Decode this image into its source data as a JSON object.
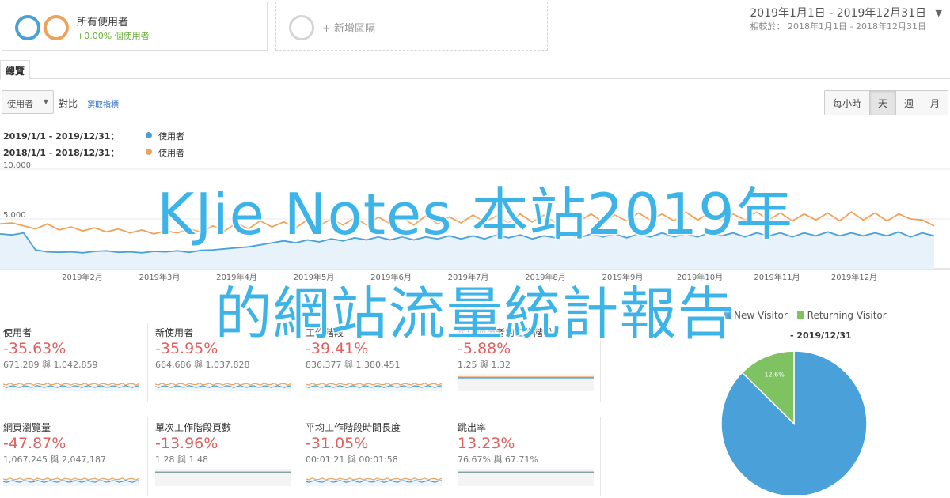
{
  "segments": {
    "all_users": {
      "title": "所有使用者",
      "subtitle": "+0.00% 個使用者"
    },
    "add_segment": {
      "label": "+ 新增區隔"
    }
  },
  "date_range": {
    "main": "2019年1月1日 - 2019年12月31日",
    "compare": "相較於：  2018年1月1日 - 2018年12月31日"
  },
  "tabs": {
    "overview": "總覽"
  },
  "controls": {
    "metric_select": "使用者",
    "vs": "對比",
    "pick_metric": "選取指標",
    "periods": [
      "每小時",
      "天",
      "週",
      "月"
    ],
    "active_period": "天"
  },
  "legend": [
    {
      "range": "2019/1/1 - 2019/12/31：",
      "name": "使用者",
      "color": "#4aa0d8"
    },
    {
      "range": "2018/1/1 - 2018/12/31：",
      "name": "使用者",
      "color": "#f0a25a"
    }
  ],
  "chart_data": {
    "type": "line",
    "y_ticks": [
      "10,000",
      "5,000"
    ],
    "ylim": [
      0,
      10000
    ],
    "grid": true,
    "x_ticks": [
      "2019年2月",
      "2019年3月",
      "2019年4月",
      "2019年5月",
      "2019年6月",
      "2019年7月",
      "2019年8月",
      "2019年9月",
      "2019年10月",
      "2019年11月",
      "2019年12月"
    ],
    "series": [
      {
        "name": "使用者",
        "period": "2019",
        "color": "#4aa0d8",
        "values": [
          3500,
          3400,
          3600,
          1900,
          1700,
          1650,
          1700,
          1600,
          1750,
          1800,
          1650,
          1700,
          1600,
          1750,
          1700,
          1800,
          1650,
          1850,
          1900,
          2000,
          2100,
          2200,
          2400,
          2600,
          2800,
          2600,
          2900,
          2700,
          3000,
          2800,
          3100,
          2900,
          3200,
          2900,
          3200,
          2900,
          3200,
          3000,
          3300,
          3000,
          3300,
          3000,
          3400,
          3100,
          3400,
          3000,
          3300,
          3100,
          3400,
          3100,
          3500,
          3200,
          3500,
          3100,
          3500,
          3200,
          3600,
          3200,
          3500,
          3200,
          3600,
          3300,
          3600,
          3200,
          3600,
          3300,
          3600,
          3200,
          3600,
          3300,
          3700,
          3300,
          3600,
          3300,
          3600,
          3300,
          3700,
          3200,
          3600,
          3300
        ]
      },
      {
        "name": "使用者",
        "period": "2018",
        "color": "#f0a25a",
        "values": [
          4500,
          4600,
          4300,
          4000,
          4500,
          3900,
          4200,
          3800,
          4100,
          3700,
          4000,
          3600,
          3900,
          3500,
          3800,
          3600,
          4000,
          3700,
          4300,
          3800,
          4600,
          4000,
          4800,
          4200,
          4700,
          4100,
          4900,
          4300,
          5000,
          4400,
          5100,
          4400,
          5200,
          4500,
          5100,
          4400,
          5300,
          4500,
          5200,
          4600,
          5400,
          4700,
          5300,
          4600,
          5500,
          4700,
          5400,
          4600,
          5600,
          4800,
          5500,
          4700,
          5400,
          4800,
          5600,
          4900,
          5500,
          4800,
          5700,
          4900,
          5600,
          4800,
          5500,
          4900,
          5700,
          4900,
          5600,
          4800,
          5500,
          4900,
          5600,
          4800,
          5700,
          4900,
          5600,
          4800,
          5500,
          5000,
          4900,
          4300
        ]
      }
    ]
  },
  "scorecards": [
    {
      "name": "使用者",
      "pct": "-35.63%",
      "vals": "671,289 與 1,042,859",
      "type": "line"
    },
    {
      "name": "新使用者",
      "pct": "-35.95%",
      "vals": "664,686 與 1,037,828",
      "type": "line"
    },
    {
      "name": "工作階段",
      "pct": "-39.41%",
      "vals": "836,377 與 1,380,451",
      "type": "line"
    },
    {
      "name": "每位使用者的工作階段",
      "pct": "-5.88%",
      "vals": "1.25 與 1.32",
      "type": "flat"
    },
    {
      "name": "網頁瀏覽量",
      "pct": "-47.87%",
      "vals": "1,067,245 與 2,047,187",
      "type": "line"
    },
    {
      "name": "單次工作階段頁數",
      "pct": "-13.96%",
      "vals": "1.28 與 1.48",
      "type": "flat"
    },
    {
      "name": "平均工作階段時間長度",
      "pct": "-31.05%",
      "vals": "00:01:21 與 00:01:58",
      "type": "line"
    },
    {
      "name": "跳出率",
      "pct": "13.23%",
      "vals": "76.67% 與 67.71%",
      "type": "flat"
    }
  ],
  "pie": {
    "legend": [
      {
        "label": "New Visitor",
        "color": "#4aa0d8"
      },
      {
        "label": "Returning Visitor",
        "color": "#7ec261"
      }
    ],
    "range": "- 2019/12/31",
    "slices": [
      {
        "label": "87.4%",
        "value": 87.4,
        "color": "#4aa0d8"
      },
      {
        "label": "12.6%",
        "value": 12.6,
        "color": "#7ec261"
      }
    ]
  },
  "overlay": {
    "line1": "KJie Notes 本站2019年",
    "line2": "的網站流量統計報告"
  }
}
